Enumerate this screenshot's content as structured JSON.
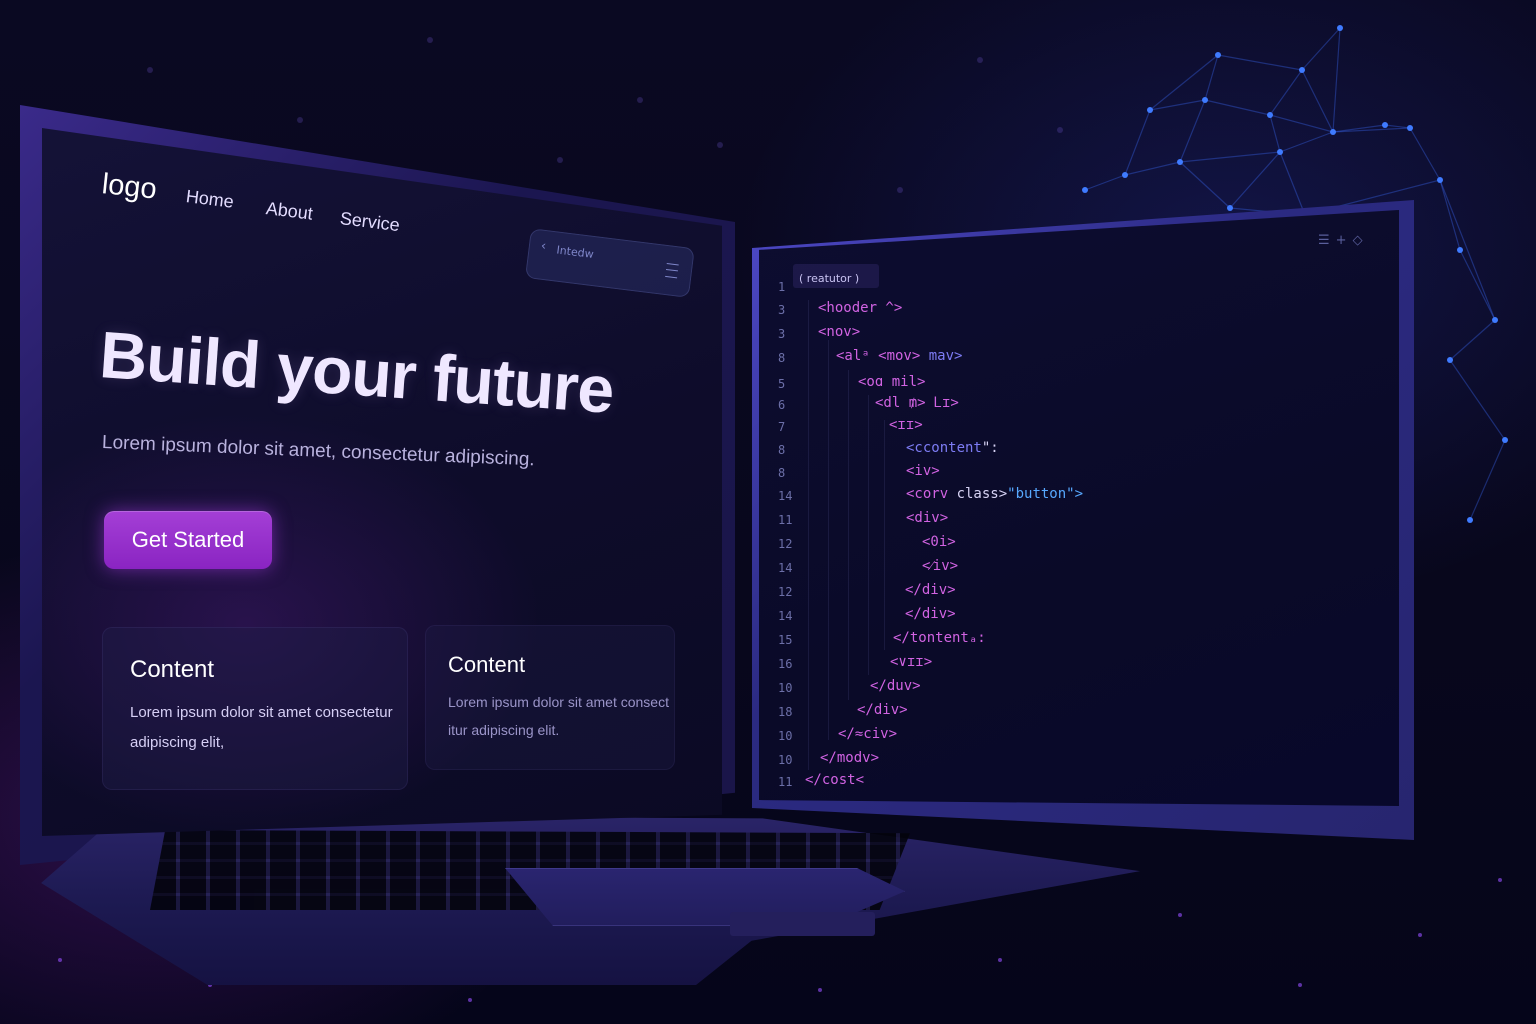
{
  "website": {
    "logo": "logo",
    "nav": [
      "Home",
      "About",
      "Service"
    ],
    "search_placeholder": "Intedw",
    "hero_title": "Build your future",
    "hero_subtitle": "Lorem ipsum dolor sit amet, consectetur adipiscing.",
    "cta_label": "Get Started",
    "cards": [
      {
        "title": "Content",
        "body_lines": [
          "Lorem ipsum dolor sit amet consectetur",
          "adipiscing elit,"
        ]
      },
      {
        "title": "Content",
        "body_lines": [
          "Lorem ipsum dolor sit amet consect",
          "itur adipiscing elit."
        ]
      }
    ]
  },
  "editor": {
    "tab_label": "( reatutor  )",
    "toolbar_icons": [
      "menu-icon",
      "plus-icon",
      "diamond-icon"
    ],
    "line_numbers": [
      "1",
      "3",
      "3",
      "8",
      "5",
      "6",
      "7",
      "8",
      "8",
      "14",
      "11",
      "12",
      "14",
      "12",
      "14",
      "15",
      "16",
      "10",
      "18",
      "10",
      "10",
      "11"
    ],
    "code_lines": [
      "<hooder ^>",
      "<nov>",
      "<alᵃ <mov>  mav>",
      "<oɑ mil>",
      "<dl ₥> Ꮮɪ>",
      "<ɪɪ>",
      "<ccontent\":",
      "<iv>",
      "<corv  class>\"button\">",
      "<div>",
      "<0i>",
      "<⁄iv>",
      "</div>",
      "</div>",
      "</tontentₐ:",
      "<∨ɪɪ>",
      "</duv>",
      "</div>",
      "</≈civ>",
      "</modv>",
      "</cost<"
    ]
  },
  "colors": {
    "background": "#07061a",
    "accent_purple": "#a43fd6",
    "code_tag": "#d163e2",
    "code_attr": "#57a8ff",
    "monitor_bezel": "#4e49c8"
  }
}
